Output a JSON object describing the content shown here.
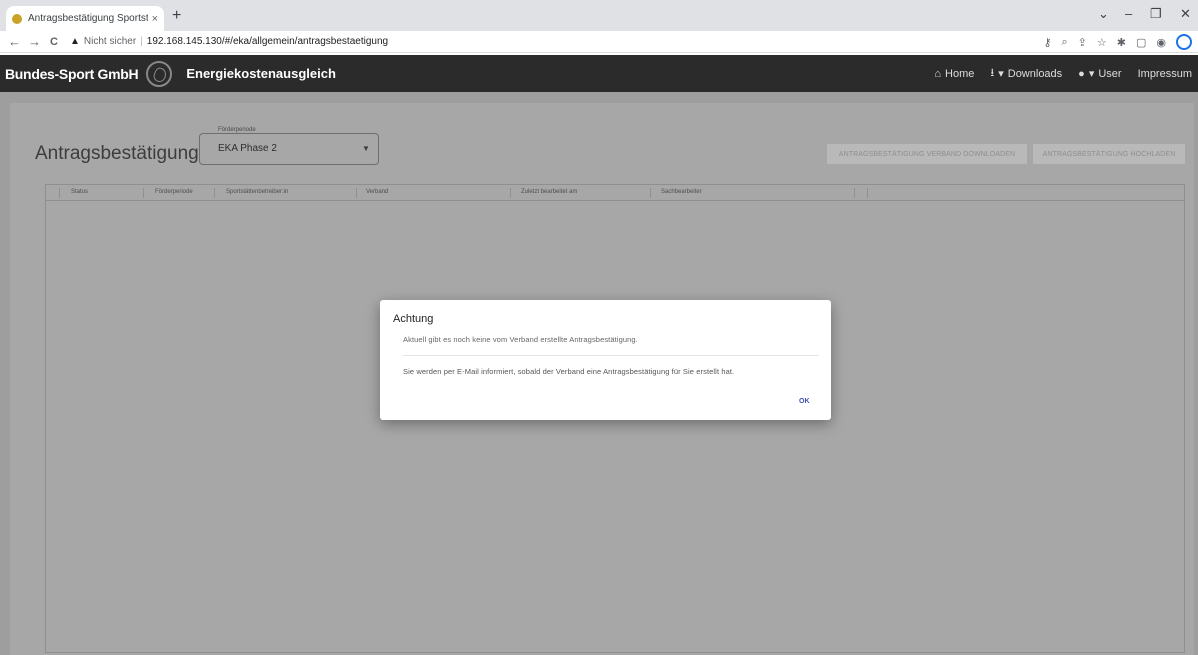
{
  "browser": {
    "tab_title": "Antragsbestätigung Sportstätten",
    "tab_close": "×",
    "new_tab": "+",
    "back_icon": "←",
    "forward_icon": "→",
    "reload_icon": "C",
    "insecure_label": "Nicht sicher",
    "url": "192.168.145.130/#/eka/allgemein/antragsbestaetigung"
  },
  "appbar": {
    "brand": "Bundes-Sport GmbH",
    "title": "Energiekostenausgleich",
    "nav": {
      "home": "Home",
      "downloads": "Downloads",
      "user": "User",
      "impressum": "Impressum"
    }
  },
  "page": {
    "title": "Antragsbestätigung",
    "period_select": {
      "label": "Förderperiode",
      "value": "EKA Phase 2"
    },
    "buttons": {
      "download": "ANTRAGSBESTÄTIGUNG VERBAND DOWNLOADEN",
      "upload": "ANTRAGSBESTÄTIGUNG HOCHLADEN"
    },
    "table": {
      "columns": [
        "Status",
        "Förderperiode",
        "Sportstättenbetreiber:in",
        "Verband",
        "Zuletzt bearbeitet am",
        "Sachbearbeiter"
      ]
    }
  },
  "dialog": {
    "title": "Achtung",
    "message1": "Aktuell gibt es noch keine vom Verband erstellte Antragsbestätigung.",
    "message2": "Sie werden per E-Mail informiert, sobald der Verband eine Antragsbestätigung für Sie erstellt hat.",
    "ok_label": "OK"
  },
  "colors": {
    "appbar": "#2b2b2b",
    "overlay": "#9e9e9e",
    "accent": "#3f51b5"
  }
}
